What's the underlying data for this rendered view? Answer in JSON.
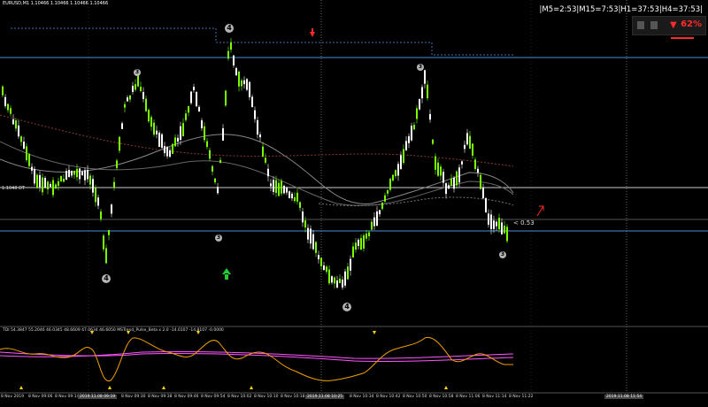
{
  "symbol": {
    "title": "EURUSD,M1  1.10466 1.10466 1.10466 1.10466"
  },
  "timers": {
    "text": "|M5=2:53|M15=7:53|H1=37:53|H4=37:53|"
  },
  "signal_panel": {
    "percent": "62%",
    "color": "#ff2a2a"
  },
  "price_level": {
    "label": "1.1048 DT"
  },
  "spread": {
    "label": "< 0.53"
  },
  "oscillator": {
    "label": "TDI 54.3847 55.2046 46.0345 48.6609 47.0634 46.6050  MSTrend_Pulse_Beta x 2.0 -14.0107 -14.8107 -0.0000"
  },
  "wave_labels": [
    "4",
    "3",
    "3",
    "3",
    "3",
    "4",
    "4"
  ],
  "time_axis": {
    "labels": [
      "8 Nov 2019",
      "8 Nov 09:06",
      "8 Nov 09:14",
      "8 Nov 09:22",
      "8 Nov 09:30",
      "8 Nov 09:38",
      "8 Nov 09:46",
      "8 Nov 09:54",
      "8 Nov 10:02",
      "8 Nov 10:10",
      "8 Nov 10:18",
      "8 Nov 10:26",
      "8 Nov 10:34",
      "8 Nov 10:42",
      "8 Nov 10:50",
      "8 Nov 10:58",
      "8 Nov 11:06",
      "8 Nov 11:14",
      "8 Nov 11:22"
    ],
    "highlight_labels": [
      "2019.11.08 09:19",
      "2019.11.08 10:25",
      "2019.11.08 11:54"
    ]
  },
  "colors": {
    "background": "#000000",
    "bull_candle": "#7CFC00",
    "bear_candle": "#ffffff",
    "support_line": "#4a8fd4",
    "level_line": "#cccccc",
    "down_arrow": "#ff2a2a",
    "up_arrow": "#22cc33",
    "rsi_line": "#f0a000",
    "signal_line": "#ff55ff",
    "arrow_marker": "#ffd700"
  }
}
